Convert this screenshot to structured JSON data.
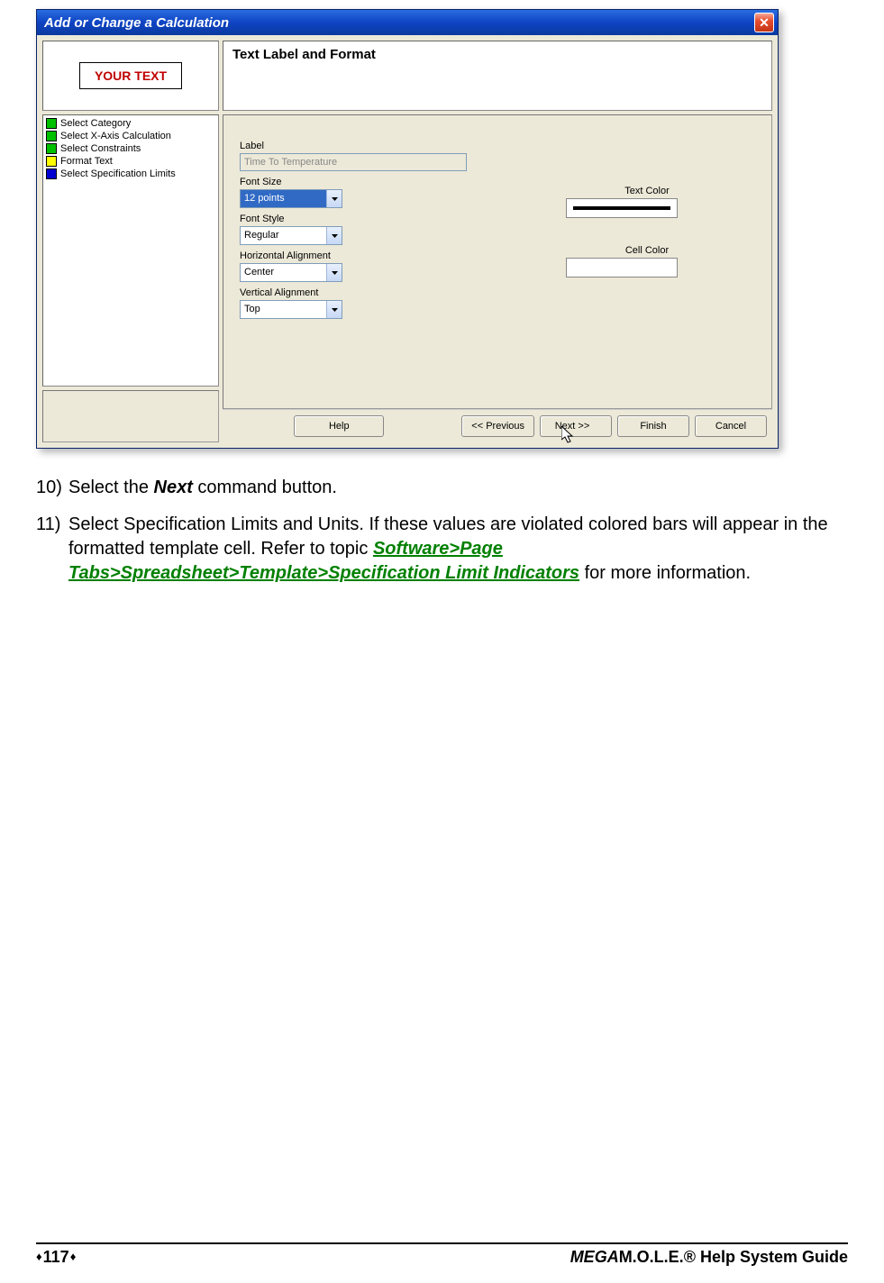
{
  "dialog": {
    "title": "Add or Change a Calculation",
    "preview_text": "YOUR TEXT",
    "heading": "Text Label and Format",
    "steps": [
      {
        "color": "green",
        "label": "Select Category"
      },
      {
        "color": "green",
        "label": "Select X-Axis Calculation"
      },
      {
        "color": "green",
        "label": "Select Constraints"
      },
      {
        "color": "yellow",
        "label": "Format Text"
      },
      {
        "color": "blue",
        "label": "Select Specification Limits"
      }
    ],
    "form": {
      "label_caption": "Label",
      "label_value": "Time To Temperature",
      "fontsize_caption": "Font Size",
      "fontsize_value": "12 points",
      "fontstyle_caption": "Font Style",
      "fontstyle_value": "Regular",
      "halign_caption": "Horizontal Alignment",
      "halign_value": "Center",
      "valign_caption": "Vertical Alignment",
      "valign_value": "Top",
      "textcolor_caption": "Text Color",
      "cellcolor_caption": "Cell Color"
    },
    "buttons": {
      "help": "Help",
      "prev": "<< Previous",
      "next": "Next >>",
      "finish": "Finish",
      "cancel": "Cancel"
    }
  },
  "instructions": {
    "step10_num": "10)",
    "step10_a": "Select the ",
    "step10_b": "Next",
    "step10_c": " command button.",
    "step11_num": "11)",
    "step11_a": "Select Specification Limits and Units. If these values are violated colored bars will appear in the formatted template cell. Refer to  topic ",
    "step11_link": "Software>Page Tabs>Spreadsheet>Template>Specification Limit Indicators",
    "step11_b": " for more information."
  },
  "footer": {
    "page": "117",
    "title_prefix": "MEGA",
    "title_suffix": "M.O.L.E.® Help System Guide"
  }
}
